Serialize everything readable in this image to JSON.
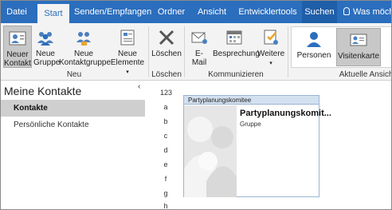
{
  "tabs": [
    "Datei",
    "Start",
    "Senden/Empfangen",
    "Ordner",
    "Ansicht",
    "Entwicklertools",
    "Suchen",
    "Was möcht"
  ],
  "tellme_icon": "lightbulb-icon",
  "ribbon": {
    "new_contact": "Neuer Kontakt",
    "new_group": "Neue Gruppe",
    "new_contact_group": "Neue Kontaktgruppe",
    "new_items": "Neue Elemente",
    "delete": "Löschen",
    "email": "E-Mail",
    "meeting": "Besprechung",
    "more": "Weitere",
    "people": "Personen",
    "business_card": "Visitenkarte",
    "group_new": "Neu",
    "group_delete": "Löschen",
    "group_communicate": "Kommunizieren",
    "group_view": "Aktuelle Ansicht"
  },
  "left": {
    "title": "Meine Kontakte",
    "collapse": "‹",
    "items": [
      "Kontakte",
      "Persönliche Kontakte"
    ]
  },
  "index": [
    "123",
    "a",
    "b",
    "c",
    "d",
    "e",
    "f",
    "g",
    "h"
  ],
  "card": {
    "header": "Partyplanungskomitee",
    "name": "Partyplanungskomit...",
    "type": "Gruppe"
  },
  "colors": {
    "tabbar": "#2b6ebd",
    "accent": "#2b6ebd",
    "card_header": "#d3e0ef"
  }
}
